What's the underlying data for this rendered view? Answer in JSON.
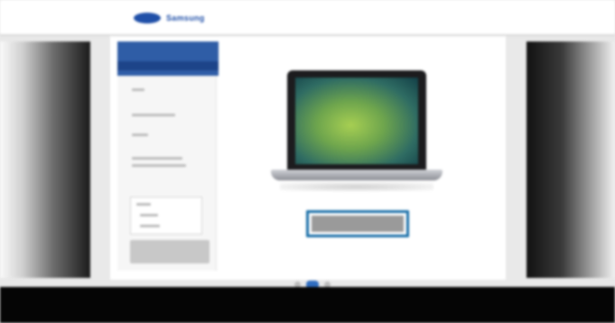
{
  "header": {
    "logo_text": "Samsung",
    "nav_items": [
      "",
      "",
      ""
    ],
    "account_text": ""
  },
  "sidebar": {
    "title": "",
    "items": [
      "",
      "",
      "",
      ""
    ],
    "box_lines": [
      "",
      "",
      ""
    ],
    "button_label": ""
  },
  "main": {
    "product": "laptop-image",
    "cta_label": ""
  },
  "carousel": {
    "count": 3,
    "active": 1
  },
  "footer": {
    "line1": "",
    "line2": ""
  },
  "colors": {
    "brand": "#1f4fa8",
    "highlight": "#1a6fa8",
    "dot_active": "#2f6dc0",
    "footer_bg": "#050505"
  }
}
